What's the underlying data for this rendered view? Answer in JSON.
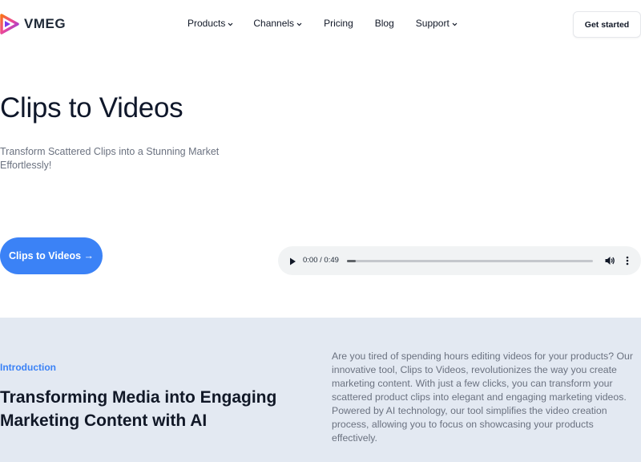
{
  "brand": {
    "name": "VMEG",
    "colors": {
      "accent": "#3b82f6",
      "logo_purple": "#7c3aed",
      "logo_orange": "#f97316"
    }
  },
  "nav": {
    "items": [
      {
        "label": "Products",
        "has_dropdown": true
      },
      {
        "label": "Channels",
        "has_dropdown": true
      },
      {
        "label": "Pricing",
        "has_dropdown": false
      },
      {
        "label": "Blog",
        "has_dropdown": false
      },
      {
        "label": "Support",
        "has_dropdown": true
      }
    ],
    "cta_label": "Get started"
  },
  "hero": {
    "title": "Clips to Videos",
    "subtitle": "Transform Scattered Clips into a Stunning Market Effortlessly!",
    "button_label": "Clips to Videos →"
  },
  "audio_player": {
    "time_display": "0:00 / 0:49",
    "progress": 0.035,
    "icons": [
      "play-icon",
      "volume-icon",
      "more-vertical-icon"
    ]
  },
  "intro": {
    "eyebrow": "Introduction",
    "heading": "Transforming Media into Engaging Marketing Content with AI",
    "body": "Are you tired of spending hours editing videos for your products? Our innovative tool, Clips to Videos, revolutionizes the way you create marketing content. With just a few clicks, you can transform your scattered product clips into elegant and engaging marketing videos. Powered by AI technology, our tool simplifies the video creation process, allowing you to focus on showcasing your products effectively."
  }
}
